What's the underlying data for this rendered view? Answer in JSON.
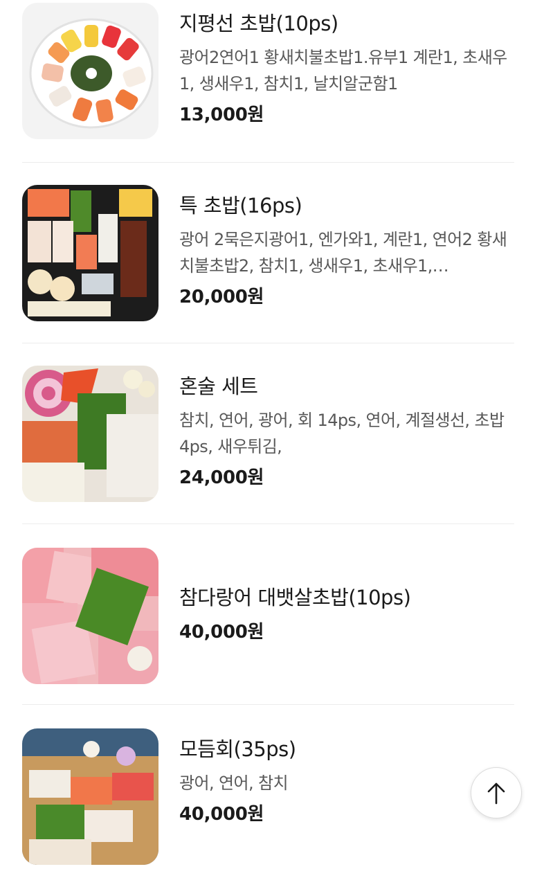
{
  "menu": {
    "items": [
      {
        "name": "지평선 초밥(10ps)",
        "description": "광어2연어1 황새치불초밥1.유부1 계란1, 초새우1, 생새우1, 참치1, 날치알군함1",
        "price": "13,000원",
        "image_icon": "sushi-platter-image"
      },
      {
        "name": "특 초밥(16ps)",
        "description": "광어 2묵은지광어1, 엔가와1, 계란1, 연어2 황새치불초밥2, 참치1, 생새우1, 초새우1,…",
        "price": "20,000원",
        "image_icon": "sushi-box-image"
      },
      {
        "name": "혼술 세트",
        "description": "참치, 연어, 광어, 회 14ps, 연어, 계절생선, 초밥 4ps, 새우튀김,",
        "price": "24,000원",
        "image_icon": "sashimi-set-image"
      },
      {
        "name": "참다랑어 대뱃살초밥(10ps)",
        "description": "",
        "price": "40,000원",
        "image_icon": "tuna-belly-image"
      },
      {
        "name": "모듬회(35ps)",
        "description": "광어, 연어, 참치",
        "price": "40,000원",
        "image_icon": "assorted-sashimi-image"
      }
    ]
  },
  "scroll_top": {
    "icon": "arrow-up-icon"
  }
}
